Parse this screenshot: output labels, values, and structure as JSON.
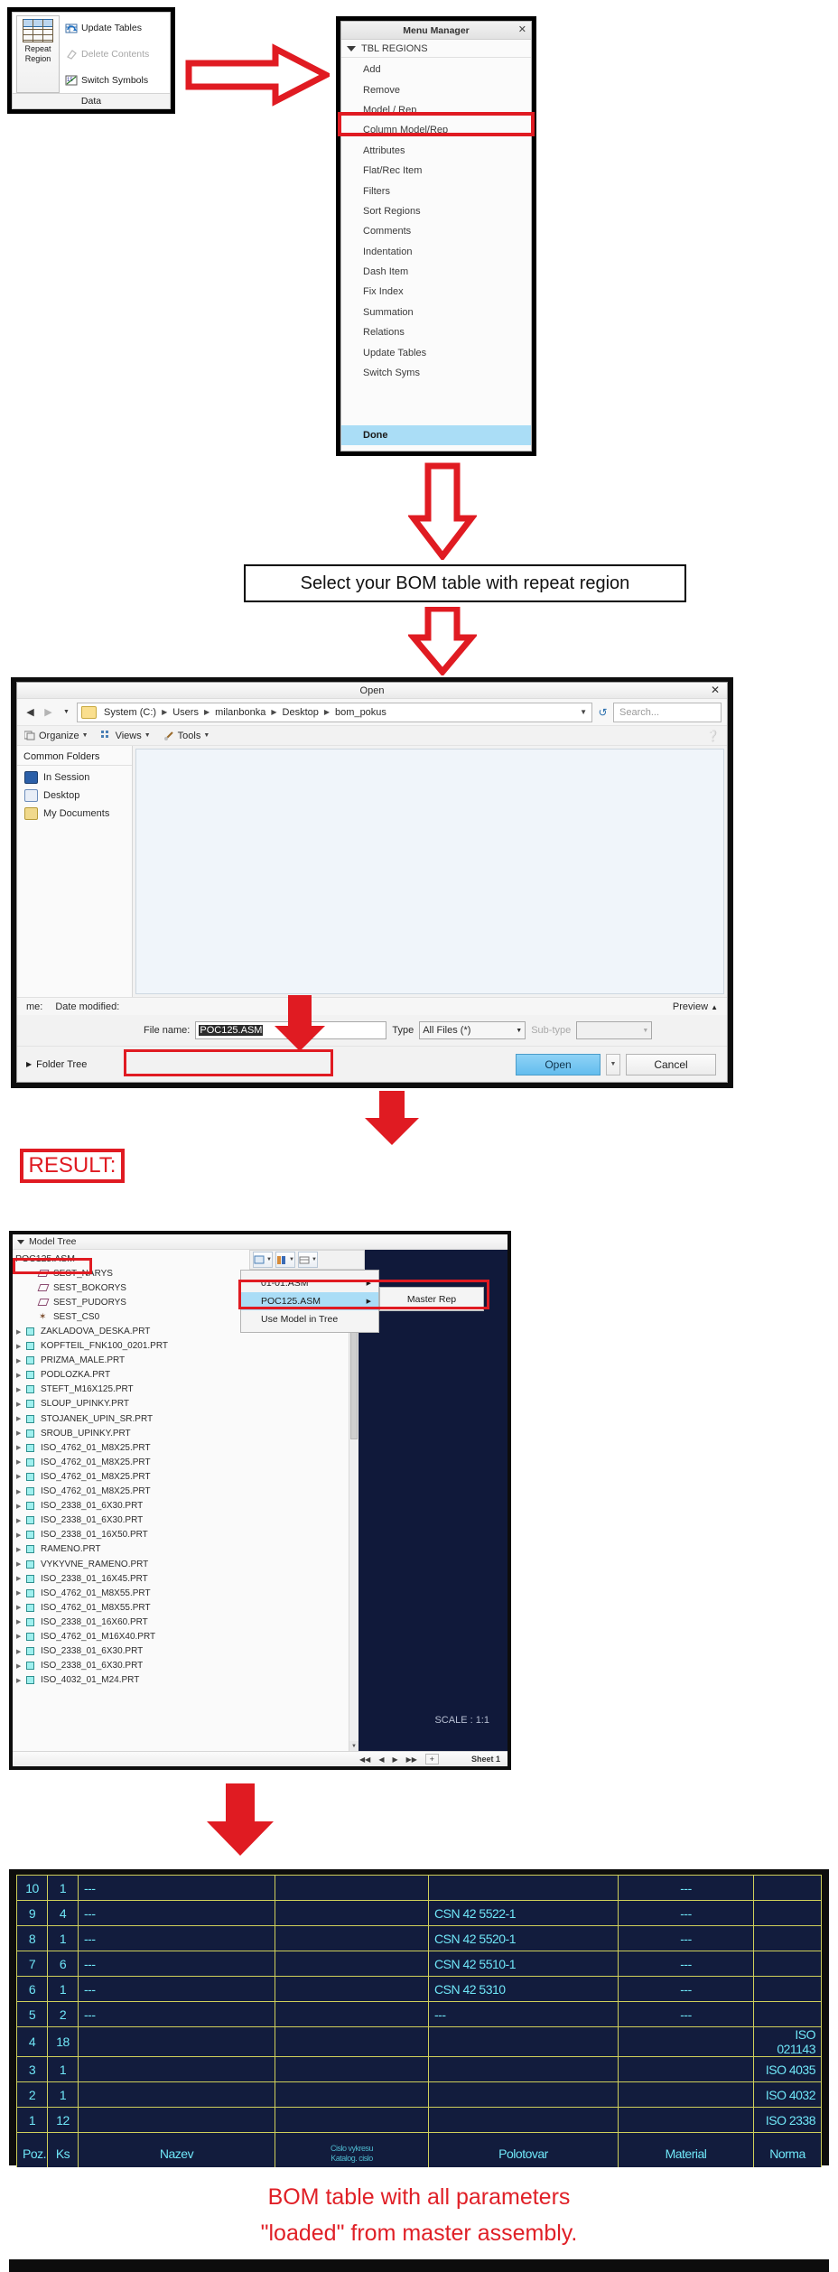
{
  "ribbon": {
    "repeat_region_line1": "Repeat",
    "repeat_region_line2": "Region",
    "commands": [
      {
        "label": "Update Tables",
        "icon": "refresh-table-icon",
        "disabled": false
      },
      {
        "label": "Delete Contents",
        "icon": "eraser-icon",
        "disabled": true
      },
      {
        "label": "Switch Symbols",
        "icon": "switch-symbols-icon",
        "disabled": false
      }
    ],
    "group_label": "Data"
  },
  "menu_manager": {
    "title": "Menu Manager",
    "close_label": "✕",
    "section": "TBL REGIONS",
    "items": [
      "Add",
      "Remove",
      "Model / Rep",
      "Column Model/Rep",
      "Attributes",
      "Flat/Rec Item",
      "Filters",
      "Sort Regions",
      "Comments",
      "Indentation",
      "Dash Item",
      "Fix Index",
      "Summation",
      "Relations",
      "Update Tables",
      "Switch Syms"
    ],
    "done": "Done",
    "highlighted_item": "Model / Rep"
  },
  "callout_select": "Select your BOM table with repeat region",
  "open_dialog": {
    "title": "Open",
    "close_label": "✕",
    "breadcrumbs": [
      "System (C:)",
      "Users",
      "milanbonka",
      "Desktop",
      "bom_pokus"
    ],
    "search_placeholder": "Search...",
    "toolbar": [
      "Organize",
      "Views",
      "Tools"
    ],
    "sidebar_title": "Common Folders",
    "sidebar_items": [
      "In Session",
      "Desktop",
      "My Documents"
    ],
    "column_headers": [
      "me:",
      "Date modified:"
    ],
    "preview_label": "Preview",
    "file_name_label": "File name:",
    "file_name_value": "POC125.ASM",
    "type_label": "Type",
    "type_value": "All Files (*)",
    "subtype_label": "Sub-type",
    "subtype_value": "",
    "folder_tree_label": "Folder Tree",
    "open_button": "Open",
    "cancel_button": "Cancel"
  },
  "result_label": "RESULT:",
  "model_tree": {
    "header": "Model Tree",
    "root": "POC125.ASM",
    "items": [
      {
        "label": "SEST_NARYS",
        "icon": "datum-plane-icon",
        "indent": 1,
        "expandable": false
      },
      {
        "label": "SEST_BOKORYS",
        "icon": "datum-plane-icon",
        "indent": 1,
        "expandable": false
      },
      {
        "label": "SEST_PUDORYS",
        "icon": "datum-plane-icon",
        "indent": 1,
        "expandable": false
      },
      {
        "label": "SEST_CS0",
        "icon": "coordinate-system-icon",
        "indent": 1,
        "expandable": false
      },
      {
        "label": "ZAKLADOVA_DESKA.PRT",
        "icon": "part-icon",
        "indent": 0,
        "expandable": true
      },
      {
        "label": "KOPFTEIL_FNK100_0201.PRT",
        "icon": "part-icon",
        "indent": 0,
        "expandable": true
      },
      {
        "label": "PRIZMA_MALE.PRT",
        "icon": "part-icon",
        "indent": 0,
        "expandable": true
      },
      {
        "label": "PODLOZKA.PRT",
        "icon": "part-icon",
        "indent": 0,
        "expandable": true
      },
      {
        "label": "STEFT_M16X125.PRT",
        "icon": "part-icon",
        "indent": 0,
        "expandable": true
      },
      {
        "label": "SLOUP_UPINKY.PRT",
        "icon": "part-icon",
        "indent": 0,
        "expandable": true
      },
      {
        "label": "STOJANEK_UPIN_SR.PRT",
        "icon": "part-icon",
        "indent": 0,
        "expandable": true
      },
      {
        "label": "SROUB_UPINKY.PRT",
        "icon": "part-icon",
        "indent": 0,
        "expandable": true
      },
      {
        "label": "ISO_4762_01_M8X25.PRT",
        "icon": "part-icon",
        "indent": 0,
        "expandable": true
      },
      {
        "label": "ISO_4762_01_M8X25.PRT",
        "icon": "part-icon",
        "indent": 0,
        "expandable": true
      },
      {
        "label": "ISO_4762_01_M8X25.PRT",
        "icon": "part-icon",
        "indent": 0,
        "expandable": true
      },
      {
        "label": "ISO_4762_01_M8X25.PRT",
        "icon": "part-icon",
        "indent": 0,
        "expandable": true
      },
      {
        "label": "ISO_2338_01_6X30.PRT",
        "icon": "part-icon",
        "indent": 0,
        "expandable": true
      },
      {
        "label": "ISO_2338_01_6X30.PRT",
        "icon": "part-icon",
        "indent": 0,
        "expandable": true
      },
      {
        "label": "ISO_2338_01_16X50.PRT",
        "icon": "part-icon",
        "indent": 0,
        "expandable": true
      },
      {
        "label": "RAMENO.PRT",
        "icon": "part-icon",
        "indent": 0,
        "expandable": true
      },
      {
        "label": "VYKYVNE_RAMENO.PRT",
        "icon": "part-icon",
        "indent": 0,
        "expandable": true
      },
      {
        "label": "ISO_2338_01_16X45.PRT",
        "icon": "part-icon",
        "indent": 0,
        "expandable": true
      },
      {
        "label": "ISO_4762_01_M8X55.PRT",
        "icon": "part-icon",
        "indent": 0,
        "expandable": true
      },
      {
        "label": "ISO_4762_01_M8X55.PRT",
        "icon": "part-icon",
        "indent": 0,
        "expandable": true
      },
      {
        "label": "ISO_2338_01_16X60.PRT",
        "icon": "part-icon",
        "indent": 0,
        "expandable": true
      },
      {
        "label": "ISO_4762_01_M16X40.PRT",
        "icon": "part-icon",
        "indent": 0,
        "expandable": true
      },
      {
        "label": "ISO_2338_01_6X30.PRT",
        "icon": "part-icon",
        "indent": 0,
        "expandable": true
      },
      {
        "label": "ISO_2338_01_6X30.PRT",
        "icon": "part-icon",
        "indent": 0,
        "expandable": true
      },
      {
        "label": "ISO_4032_01_M24.PRT",
        "icon": "part-icon",
        "indent": 0,
        "expandable": true
      }
    ],
    "popup": {
      "items": [
        {
          "label": "01-01.ASM",
          "selected": false,
          "has_submenu": true
        },
        {
          "label": "POC125.ASM",
          "selected": true,
          "has_submenu": true
        },
        {
          "label": "Use Model in Tree",
          "selected": false,
          "has_submenu": false
        }
      ],
      "submenu": "Master Rep"
    },
    "scale": "SCALE : 1:1",
    "sheet": "Sheet 1"
  },
  "chart_data": {
    "type": "table",
    "title": "BOM table",
    "columns": [
      "Poz.",
      "Ks",
      "Nazev",
      "Cislo vykresu / Katalog. cislo",
      "Polotovar",
      "Material",
      "Norma"
    ],
    "header_labels": {
      "poz": "Poz.",
      "ks": "Ks",
      "nazev": "Nazev",
      "cislo_line1": "Cislo vykresu",
      "cislo_line2": "Katalog. cislo",
      "polotovar": "Polotovar",
      "material": "Material",
      "norma": "Norma"
    },
    "rows": [
      {
        "poz": "10",
        "ks": "1",
        "nazev": "---",
        "cislo": "",
        "polotovar": "",
        "material": "---",
        "norma": ""
      },
      {
        "poz": "9",
        "ks": "4",
        "nazev": "---",
        "cislo": "",
        "polotovar": "CSN 42 5522-1",
        "material": "---",
        "norma": ""
      },
      {
        "poz": "8",
        "ks": "1",
        "nazev": "---",
        "cislo": "",
        "polotovar": "CSN 42 5520-1",
        "material": "---",
        "norma": ""
      },
      {
        "poz": "7",
        "ks": "6",
        "nazev": "---",
        "cislo": "",
        "polotovar": "CSN 42 5510-1",
        "material": "---",
        "norma": ""
      },
      {
        "poz": "6",
        "ks": "1",
        "nazev": "---",
        "cislo": "",
        "polotovar": "CSN 42 5310",
        "material": "---",
        "norma": ""
      },
      {
        "poz": "5",
        "ks": "2",
        "nazev": "---",
        "cislo": "",
        "polotovar": "---",
        "material": "---",
        "norma": ""
      },
      {
        "poz": "4",
        "ks": "18",
        "nazev": "",
        "cislo": "",
        "polotovar": "",
        "material": "",
        "norma": "ISO 021143"
      },
      {
        "poz": "3",
        "ks": "1",
        "nazev": "",
        "cislo": "",
        "polotovar": "",
        "material": "",
        "norma": "ISO 4035"
      },
      {
        "poz": "2",
        "ks": "1",
        "nazev": "",
        "cislo": "",
        "polotovar": "",
        "material": "",
        "norma": "ISO 4032"
      },
      {
        "poz": "1",
        "ks": "12",
        "nazev": "",
        "cislo": "",
        "polotovar": "",
        "material": "",
        "norma": "ISO 2338"
      }
    ]
  },
  "bom_caption": {
    "line1": "BOM table with all parameters",
    "line2": "\"loaded\" from master assembly."
  },
  "colors": {
    "accent_red": "#e01b22",
    "highlight_blue": "#aaddf6",
    "table_bg": "#121c3d",
    "table_text": "#6fe6f7",
    "table_grid": "#cfcf5a"
  }
}
